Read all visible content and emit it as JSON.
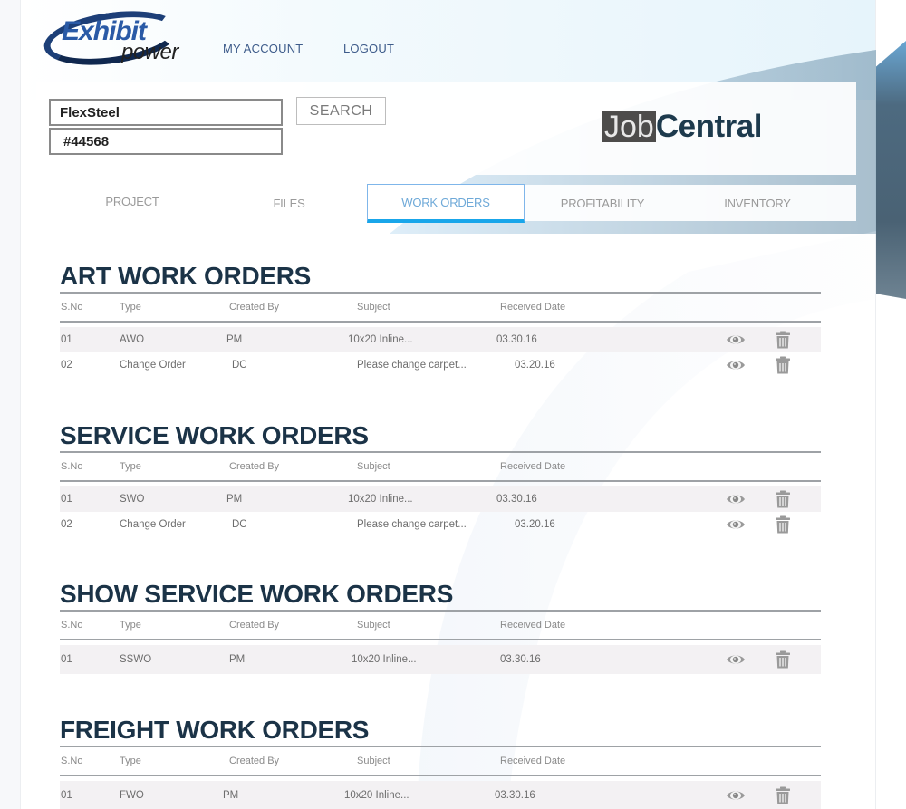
{
  "header": {
    "logo": {
      "line1": "Exhibit",
      "line2": "power"
    },
    "links": {
      "my_account": "MY ACCOUNT",
      "logout": "LOGOUT"
    },
    "client_field": {
      "value": "FlexSteel"
    },
    "job_field": {
      "value": "#44568"
    },
    "search_label": "SEARCH",
    "app_title": {
      "part1": "Job",
      "part2": "Central"
    }
  },
  "tabs": [
    {
      "label": "PROJECT",
      "active": false
    },
    {
      "label": "FILES",
      "active": false
    },
    {
      "label": "WORK ORDERS",
      "active": true
    },
    {
      "label": "PROFITABILITY",
      "active": false
    },
    {
      "label": "INVENTORY",
      "active": false
    }
  ],
  "columns": {
    "sno": "S.No",
    "type": "Type",
    "created_by": "Created By",
    "subject": "Subject",
    "received_date": "Received Date"
  },
  "icons": {
    "view": "eye-icon",
    "delete": "trash-icon"
  },
  "colors": {
    "accent": "#19a6ea",
    "title": "#1b3347",
    "tab_active_text": "#6ea9d8"
  },
  "sections": [
    {
      "title": "ART WORK ORDERS",
      "rows": [
        {
          "sno": "01",
          "type": "AWO",
          "created_by": "PM",
          "subject": "10x20 Inline...",
          "received_date": "03.30.16"
        },
        {
          "sno": "02",
          "type": "Change Order",
          "created_by": "DC",
          "subject": "Please change carpet...",
          "received_date": "03.20.16"
        }
      ]
    },
    {
      "title": "SERVICE WORK ORDERS",
      "rows": [
        {
          "sno": "01",
          "type": "SWO",
          "created_by": "PM",
          "subject": "10x20 Inline...",
          "received_date": "03.30.16"
        },
        {
          "sno": "02",
          "type": "Change Order",
          "created_by": "DC",
          "subject": "Please change carpet...",
          "received_date": "03.20.16"
        }
      ]
    },
    {
      "title": "SHOW SERVICE WORK ORDERS",
      "rows": [
        {
          "sno": "01",
          "type": "SSWO",
          "created_by": "PM",
          "subject": "10x20 Inline...",
          "received_date": "03.30.16"
        }
      ]
    },
    {
      "title": "FREIGHT WORK ORDERS",
      "rows": [
        {
          "sno": "01",
          "type": "FWO",
          "created_by": "PM",
          "subject": "10x20 Inline...",
          "received_date": "03.30.16"
        }
      ]
    }
  ]
}
